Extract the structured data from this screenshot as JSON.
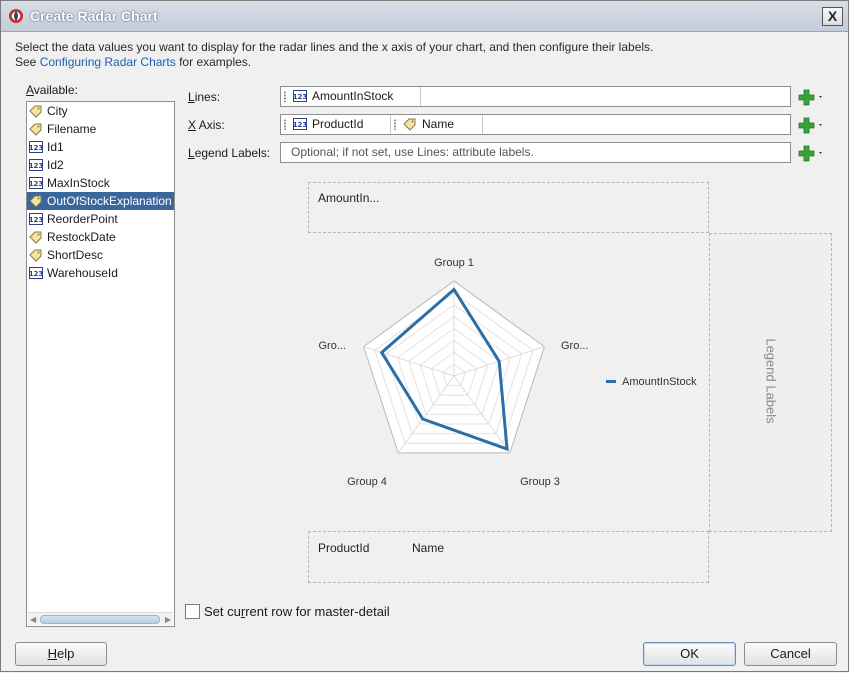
{
  "window": {
    "title": "Create Radar Chart",
    "close_label": "X"
  },
  "description": {
    "line1": "Select the data values you want to display for the radar lines and the x axis of your chart, and then configure their labels.",
    "line2_prefix": "See ",
    "link": "Configuring Radar Charts",
    "line2_suffix": " for examples."
  },
  "available": {
    "label_mnemonic": "A",
    "label_rest": "vailable:",
    "items": [
      {
        "label": "City",
        "icon": "text-tag-icon"
      },
      {
        "label": "Filename",
        "icon": "text-tag-icon"
      },
      {
        "label": "Id1",
        "icon": "numeric-123-icon"
      },
      {
        "label": "Id2",
        "icon": "numeric-123-icon"
      },
      {
        "label": "MaxInStock",
        "icon": "numeric-123-icon"
      },
      {
        "label": "OutOfStockExplanation",
        "icon": "text-tag-icon",
        "selected": true
      },
      {
        "label": "ReorderPoint",
        "icon": "numeric-123-icon"
      },
      {
        "label": "RestockDate",
        "icon": "text-tag-icon"
      },
      {
        "label": "ShortDesc",
        "icon": "text-tag-icon"
      },
      {
        "label": "WarehouseId",
        "icon": "numeric-123-icon"
      }
    ]
  },
  "fields": {
    "lines": {
      "mnemonic": "L",
      "rest": "ines:",
      "chips": [
        "AmountInStock"
      ]
    },
    "xaxis": {
      "mnemonic": "X",
      "rest": " Axis:",
      "chips": [
        "ProductId",
        "Name"
      ]
    },
    "legend": {
      "mnemonic": "L",
      "rest": "egend Labels:",
      "placeholder": "Optional; if not set, use Lines: attribute labels."
    }
  },
  "preview": {
    "top_label": "AmountIn...",
    "bottom_label_1": "ProductId",
    "bottom_label_2": "Name",
    "legend_side_label": "Legend Labels",
    "radar_labels": {
      "group1": "Group 1",
      "right": "Gro...",
      "left": "Gro...",
      "group3": "Group 3",
      "group4": "Group 4"
    },
    "legend_entry": "AmountInStock",
    "series_color": "#2c6fa8"
  },
  "radar_values": [
    0.91,
    0.5,
    0.95,
    0.56,
    0.8
  ],
  "checkbox": {
    "label_prefix": "Set cu",
    "label_mnemonic": "r",
    "label_suffix": "rent row for master-detail",
    "checked": false
  },
  "buttons": {
    "help_mnemonic": "H",
    "help_rest": "elp",
    "ok": "OK",
    "cancel": "Cancel"
  }
}
